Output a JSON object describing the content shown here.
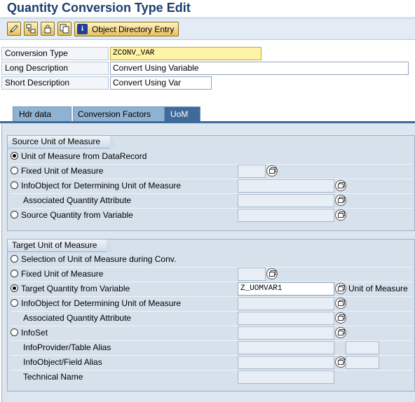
{
  "title": "Quantity Conversion Type Edit",
  "toolbar": {
    "object_directory_label": "Object Directory Entry",
    "buttons": [
      "edit-icon",
      "hierarchy-icon",
      "lock-icon",
      "copy-icon"
    ]
  },
  "header": {
    "conversion_type_label": "Conversion Type",
    "conversion_type_value": "ZCONV_VAR",
    "long_description_label": "Long Description",
    "long_description_value": "Convert Using Variable",
    "short_description_label": "Short Description",
    "short_description_value": "Convert Using Var"
  },
  "tabs": [
    {
      "label": "Hdr data",
      "active": false
    },
    {
      "label": "Conversion Factors",
      "active": false
    },
    {
      "label": "UoM",
      "active": true
    }
  ],
  "source": {
    "title": "Source Unit of Measure",
    "options": [
      {
        "label": "Unit of Measure from DataRecord",
        "selected": true
      },
      {
        "label": "Fixed Unit of Measure",
        "selected": false
      },
      {
        "label": "InfoObject for Determining Unit of Measure",
        "selected": false
      },
      {
        "label": "Associated Quantity Attribute"
      },
      {
        "label": "Source Quantity from Variable",
        "selected": false
      }
    ]
  },
  "target": {
    "title": "Target Unit of Measure",
    "options": [
      {
        "label": "Selection of Unit of Measure during Conv.",
        "selected": false
      },
      {
        "label": "Fixed Unit of Measure",
        "selected": false
      },
      {
        "label": "Target Quantity from Variable",
        "selected": true,
        "value": "Z_UOMVAR1",
        "suffix": "Unit of Measure"
      },
      {
        "label": "InfoObject for Determining Unit of Measure",
        "selected": false
      },
      {
        "label": "Associated Quantity Attribute"
      },
      {
        "label": "InfoSet",
        "selected": false
      },
      {
        "label": "InfoProvider/Table Alias"
      },
      {
        "label": "InfoObject/Field Alias"
      },
      {
        "label": "Technical Name"
      }
    ]
  },
  "colors": {
    "title": "#1d3f6e",
    "tab_active": "#3e6b99",
    "tab_inactive": "#8fb2d3",
    "key_field": "#fff3a6"
  }
}
